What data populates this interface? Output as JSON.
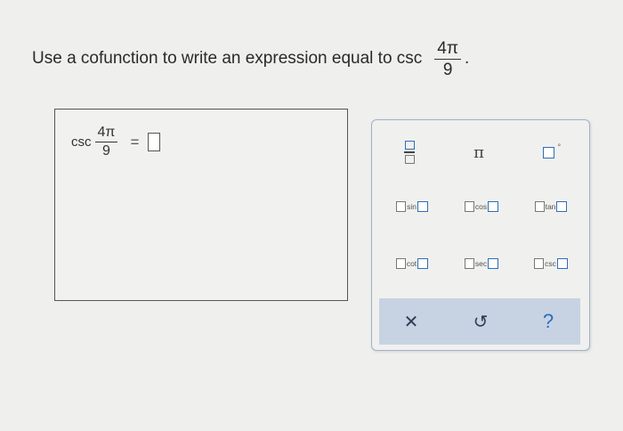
{
  "question": {
    "text": "Use a cofunction to write an expression equal to csc",
    "frac_num": "4π",
    "frac_den": "9",
    "period": "."
  },
  "answer": {
    "func": "csc",
    "frac_num": "4π",
    "frac_den": "9",
    "equals": "="
  },
  "palette": {
    "pi": "π",
    "degree": "°",
    "functions": [
      {
        "label": "sin"
      },
      {
        "label": "cos"
      },
      {
        "label": "tan"
      },
      {
        "label": "cot"
      },
      {
        "label": "sec"
      },
      {
        "label": "csc"
      }
    ],
    "actions": {
      "clear": "✕",
      "undo": "↺",
      "help": "?"
    }
  },
  "colors": {
    "accent": "#2f6fb6",
    "action_bar": "#c7d3e3",
    "background": "#efefed"
  }
}
